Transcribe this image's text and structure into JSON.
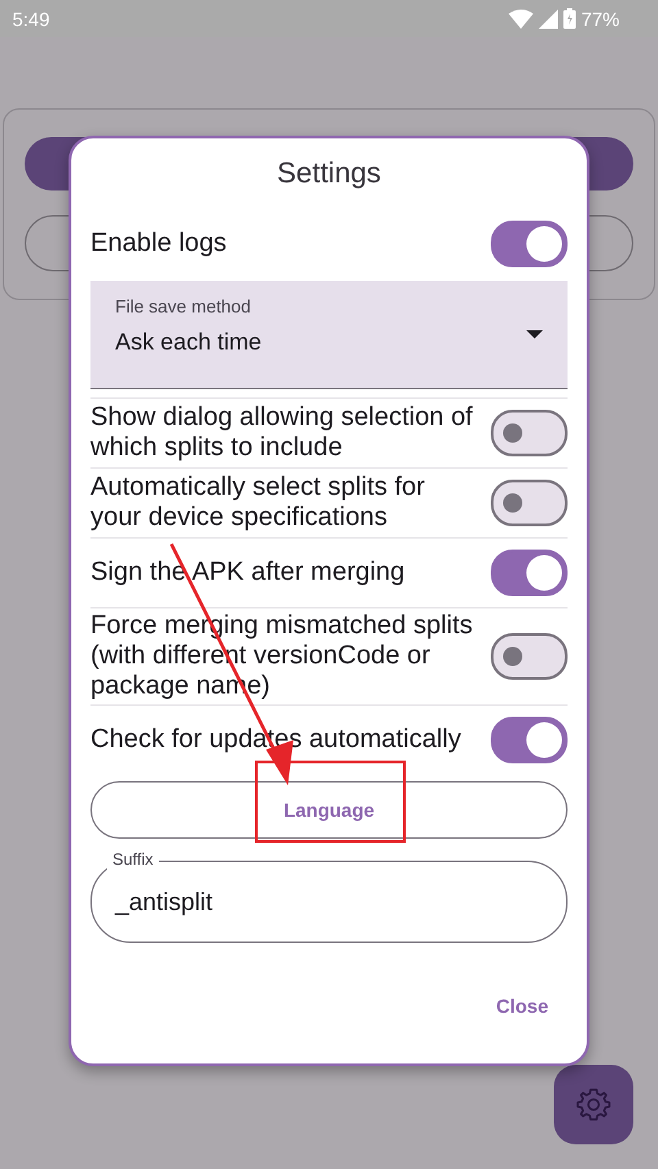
{
  "status_bar": {
    "time": "5:49",
    "battery": "77%"
  },
  "dialog": {
    "title": "Settings",
    "items": [
      {
        "kind": "switch",
        "label": "Enable logs",
        "on": true
      },
      {
        "kind": "dropdown",
        "label": "File save method",
        "value": "Ask each time"
      },
      {
        "kind": "switch",
        "label": "Show dialog allowing selection of which splits to include",
        "on": false
      },
      {
        "kind": "switch",
        "label": "Automatically select splits for your device specifications",
        "on": false
      },
      {
        "kind": "switch",
        "label": "Sign the APK after merging",
        "on": true
      },
      {
        "kind": "switch",
        "label": "Force merging mismatched splits (with different versionCode or package name)",
        "on": false
      },
      {
        "kind": "switch",
        "label": "Check for updates automatically",
        "on": true
      },
      {
        "kind": "button",
        "label": "Language"
      },
      {
        "kind": "field",
        "label": "Suffix",
        "value": "_antisplit"
      }
    ],
    "buttons": [
      "Close"
    ]
  }
}
